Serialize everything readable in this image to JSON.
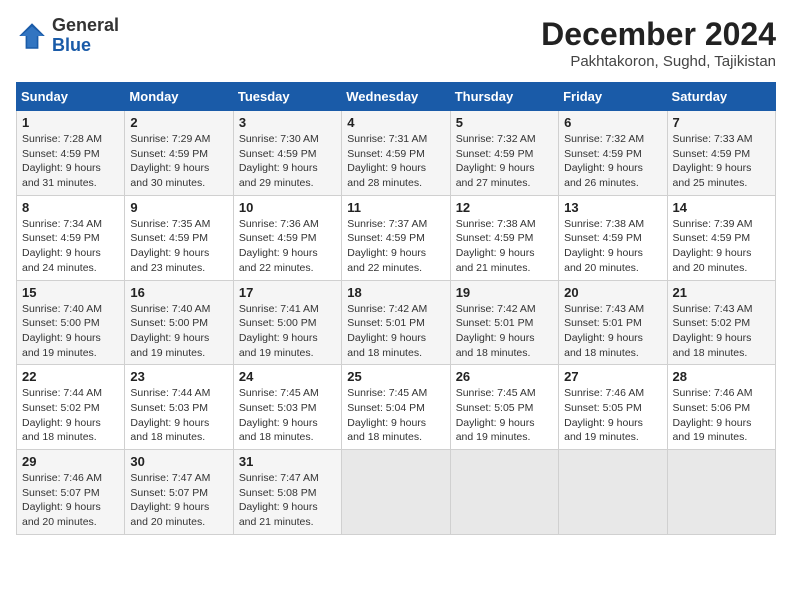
{
  "header": {
    "logo_general": "General",
    "logo_blue": "Blue",
    "title": "December 2024",
    "subtitle": "Pakhtakoron, Sughd, Tajikistan"
  },
  "days_of_week": [
    "Sunday",
    "Monday",
    "Tuesday",
    "Wednesday",
    "Thursday",
    "Friday",
    "Saturday"
  ],
  "weeks": [
    [
      {
        "day": "1",
        "sunrise": "7:28 AM",
        "sunset": "4:59 PM",
        "daylight": "9 hours and 31 minutes."
      },
      {
        "day": "2",
        "sunrise": "7:29 AM",
        "sunset": "4:59 PM",
        "daylight": "9 hours and 30 minutes."
      },
      {
        "day": "3",
        "sunrise": "7:30 AM",
        "sunset": "4:59 PM",
        "daylight": "9 hours and 29 minutes."
      },
      {
        "day": "4",
        "sunrise": "7:31 AM",
        "sunset": "4:59 PM",
        "daylight": "9 hours and 28 minutes."
      },
      {
        "day": "5",
        "sunrise": "7:32 AM",
        "sunset": "4:59 PM",
        "daylight": "9 hours and 27 minutes."
      },
      {
        "day": "6",
        "sunrise": "7:32 AM",
        "sunset": "4:59 PM",
        "daylight": "9 hours and 26 minutes."
      },
      {
        "day": "7",
        "sunrise": "7:33 AM",
        "sunset": "4:59 PM",
        "daylight": "9 hours and 25 minutes."
      }
    ],
    [
      {
        "day": "8",
        "sunrise": "7:34 AM",
        "sunset": "4:59 PM",
        "daylight": "9 hours and 24 minutes."
      },
      {
        "day": "9",
        "sunrise": "7:35 AM",
        "sunset": "4:59 PM",
        "daylight": "9 hours and 23 minutes."
      },
      {
        "day": "10",
        "sunrise": "7:36 AM",
        "sunset": "4:59 PM",
        "daylight": "9 hours and 22 minutes."
      },
      {
        "day": "11",
        "sunrise": "7:37 AM",
        "sunset": "4:59 PM",
        "daylight": "9 hours and 22 minutes."
      },
      {
        "day": "12",
        "sunrise": "7:38 AM",
        "sunset": "4:59 PM",
        "daylight": "9 hours and 21 minutes."
      },
      {
        "day": "13",
        "sunrise": "7:38 AM",
        "sunset": "4:59 PM",
        "daylight": "9 hours and 20 minutes."
      },
      {
        "day": "14",
        "sunrise": "7:39 AM",
        "sunset": "4:59 PM",
        "daylight": "9 hours and 20 minutes."
      }
    ],
    [
      {
        "day": "15",
        "sunrise": "7:40 AM",
        "sunset": "5:00 PM",
        "daylight": "9 hours and 19 minutes."
      },
      {
        "day": "16",
        "sunrise": "7:40 AM",
        "sunset": "5:00 PM",
        "daylight": "9 hours and 19 minutes."
      },
      {
        "day": "17",
        "sunrise": "7:41 AM",
        "sunset": "5:00 PM",
        "daylight": "9 hours and 19 minutes."
      },
      {
        "day": "18",
        "sunrise": "7:42 AM",
        "sunset": "5:01 PM",
        "daylight": "9 hours and 18 minutes."
      },
      {
        "day": "19",
        "sunrise": "7:42 AM",
        "sunset": "5:01 PM",
        "daylight": "9 hours and 18 minutes."
      },
      {
        "day": "20",
        "sunrise": "7:43 AM",
        "sunset": "5:01 PM",
        "daylight": "9 hours and 18 minutes."
      },
      {
        "day": "21",
        "sunrise": "7:43 AM",
        "sunset": "5:02 PM",
        "daylight": "9 hours and 18 minutes."
      }
    ],
    [
      {
        "day": "22",
        "sunrise": "7:44 AM",
        "sunset": "5:02 PM",
        "daylight": "9 hours and 18 minutes."
      },
      {
        "day": "23",
        "sunrise": "7:44 AM",
        "sunset": "5:03 PM",
        "daylight": "9 hours and 18 minutes."
      },
      {
        "day": "24",
        "sunrise": "7:45 AM",
        "sunset": "5:03 PM",
        "daylight": "9 hours and 18 minutes."
      },
      {
        "day": "25",
        "sunrise": "7:45 AM",
        "sunset": "5:04 PM",
        "daylight": "9 hours and 18 minutes."
      },
      {
        "day": "26",
        "sunrise": "7:45 AM",
        "sunset": "5:05 PM",
        "daylight": "9 hours and 19 minutes."
      },
      {
        "day": "27",
        "sunrise": "7:46 AM",
        "sunset": "5:05 PM",
        "daylight": "9 hours and 19 minutes."
      },
      {
        "day": "28",
        "sunrise": "7:46 AM",
        "sunset": "5:06 PM",
        "daylight": "9 hours and 19 minutes."
      }
    ],
    [
      {
        "day": "29",
        "sunrise": "7:46 AM",
        "sunset": "5:07 PM",
        "daylight": "9 hours and 20 minutes."
      },
      {
        "day": "30",
        "sunrise": "7:47 AM",
        "sunset": "5:07 PM",
        "daylight": "9 hours and 20 minutes."
      },
      {
        "day": "31",
        "sunrise": "7:47 AM",
        "sunset": "5:08 PM",
        "daylight": "9 hours and 21 minutes."
      },
      null,
      null,
      null,
      null
    ]
  ],
  "labels": {
    "sunrise": "Sunrise:",
    "sunset": "Sunset:",
    "daylight": "Daylight:"
  }
}
